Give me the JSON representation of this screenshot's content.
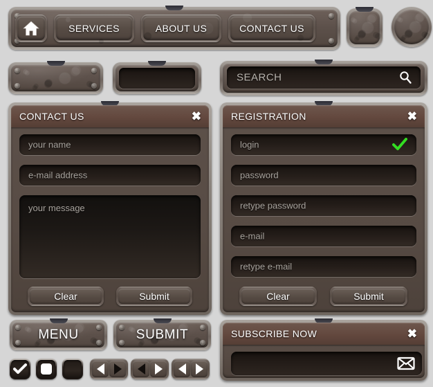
{
  "theme": {
    "background": "#d6d6d6",
    "metal_light": "#a9a39d",
    "metal_dark": "#51463f",
    "panel_title_brown": "#63483e",
    "field_dark": "#241d19",
    "accent_green": "#33dd22",
    "text_white": "#ffffff",
    "placeholder_gray": "#a9a49e"
  },
  "navbar": {
    "home_icon": "home-icon",
    "items": [
      {
        "label": "SERVICES"
      },
      {
        "label": "ABOUT US"
      },
      {
        "label": "CONTACT US"
      }
    ]
  },
  "extras": {
    "square_button": "blank-square-button",
    "round_button": "blank-round-button",
    "plate": "riveted-plate",
    "small_input": ""
  },
  "search": {
    "placeholder": "SEARCH",
    "icon": "magnifier-icon"
  },
  "contact_panel": {
    "title": "CONTACT US",
    "close": "✖",
    "fields": [
      {
        "placeholder": "your name"
      },
      {
        "placeholder": "e-mail address"
      }
    ],
    "textarea": {
      "placeholder": "your message"
    },
    "buttons": [
      {
        "label": "Clear"
      },
      {
        "label": "Submit"
      }
    ]
  },
  "registration_panel": {
    "title": "REGISTRATION",
    "close": "✖",
    "fields": [
      {
        "placeholder": "login",
        "valid": true
      },
      {
        "placeholder": "password",
        "valid": false
      },
      {
        "placeholder": "retype password",
        "valid": false
      },
      {
        "placeholder": "e-mail",
        "valid": false
      },
      {
        "placeholder": "retype e-mail",
        "valid": false
      }
    ],
    "buttons": [
      {
        "label": "Clear"
      },
      {
        "label": "Submit"
      }
    ]
  },
  "big_buttons": [
    {
      "label": "MENU"
    },
    {
      "label": "SUBMIT"
    }
  ],
  "subscribe_panel": {
    "title": "SUBSCRIBE NOW",
    "close": "✖",
    "input_value": "",
    "icon": "envelope-icon"
  },
  "checkboxes": [
    {
      "state": "checked",
      "icon": "checkmark-icon"
    },
    {
      "state": "selected",
      "icon": "filled-square-icon"
    },
    {
      "state": "empty",
      "icon": ""
    }
  ],
  "arrow_pairs": [
    {
      "left": "white",
      "right": "black"
    },
    {
      "left": "black",
      "right": "white"
    },
    {
      "left": "white",
      "right": "white"
    }
  ]
}
